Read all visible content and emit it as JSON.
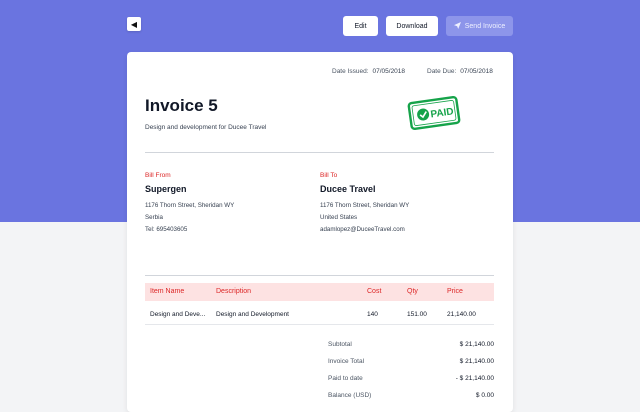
{
  "toolbar": {
    "back_icon": "chevron-left-icon",
    "edit_label": "Edit",
    "download_label": "Download",
    "send_label": "Send Invoice",
    "send_icon": "paper-plane-icon"
  },
  "colors": {
    "header_band": "#6a74e0",
    "accent_red": "#dc2626",
    "table_header_bg": "#fde2e2",
    "stamp_green": "#16a34a"
  },
  "invoice": {
    "date_issued_label": "Date Issued:",
    "date_issued": "07/05/2018",
    "date_due_label": "Date Due:",
    "date_due": "07/05/2018",
    "title": "Invoice 5",
    "subtitle": "Design and development for Ducee Travel",
    "stamp_text": "PAID"
  },
  "bill_from": {
    "label": "Bill From",
    "name": "Supergen",
    "address": "1176 Thorn Street, Sheridan WY",
    "country": "Serbia",
    "contact": "Tel: 695403605"
  },
  "bill_to": {
    "label": "Bill To",
    "name": "Ducee Travel",
    "address": "1176 Thorn Street, Sheridan WY",
    "country": "United States",
    "contact": "adamlopez@DuceeTravel.com"
  },
  "table": {
    "headers": [
      "Item Name",
      "Description",
      "Cost",
      "Qty",
      "Price"
    ],
    "rows": [
      [
        "Design and Deve...",
        "Design and Development",
        "140",
        "151.00",
        "21,140.00"
      ]
    ]
  },
  "totals": [
    {
      "label": "Subtotal",
      "value": "$ 21,140.00"
    },
    {
      "label": "Invoice Total",
      "value": "$ 21,140.00"
    },
    {
      "label": "Paid to date",
      "value": "- $ 21,140.00"
    },
    {
      "label": "Balance (USD)",
      "value": "$ 0.00"
    }
  ]
}
